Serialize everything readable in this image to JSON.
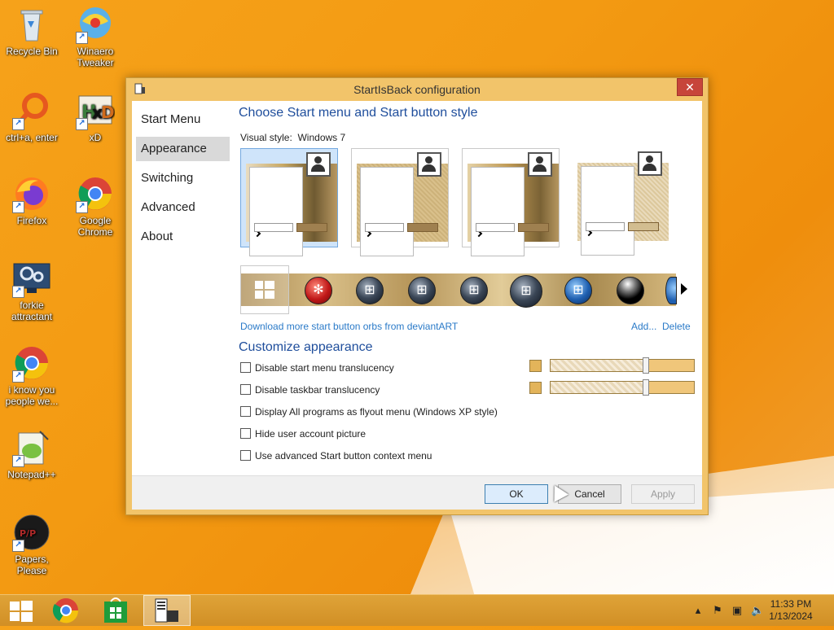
{
  "desktop": {
    "icons": [
      {
        "label": "Recycle Bin"
      },
      {
        "label": "Winaero Tweaker"
      },
      {
        "label": "ctrl+a, enter"
      },
      {
        "label": "xD"
      },
      {
        "label": "Firefox"
      },
      {
        "label": "Google Chrome"
      },
      {
        "label": "forkie attractant"
      },
      {
        "label": "i know you people we..."
      },
      {
        "label": "Notepad++"
      },
      {
        "label": "Papers, Please"
      }
    ]
  },
  "dialog": {
    "title": "StartIsBack configuration",
    "close_glyph": "✕",
    "nav": [
      "Start Menu",
      "Appearance",
      "Switching",
      "Advanced",
      "About"
    ],
    "selected_nav": "Appearance",
    "section1_title": "Choose Start menu and Start button style",
    "visual_style_label": "Visual style:",
    "visual_style_value": "Windows 7",
    "download_link": "Download more start button orbs from deviantART",
    "add_link": "Add...",
    "delete_link": "Delete",
    "section2_title": "Customize appearance",
    "options": [
      {
        "label": "Disable start menu translucency",
        "checked": false
      },
      {
        "label": "Disable taskbar translucency",
        "checked": false
      },
      {
        "label": "Display All programs as flyout menu (Windows XP style)",
        "checked": false
      },
      {
        "label": "Hide user account picture",
        "checked": false
      },
      {
        "label": "Use advanced Start button context menu",
        "checked": false
      }
    ],
    "translucency_slider_level": 0.66,
    "buttons": {
      "ok": "OK",
      "cancel": "Cancel",
      "apply": "Apply"
    }
  },
  "taskbar": {
    "time": "11:33 PM",
    "date": "1/13/2024"
  },
  "colors": {
    "accent": "#f2c46a",
    "title_link": "#1f4e9c",
    "link": "#2a7ac8",
    "close": "#c7453a"
  }
}
